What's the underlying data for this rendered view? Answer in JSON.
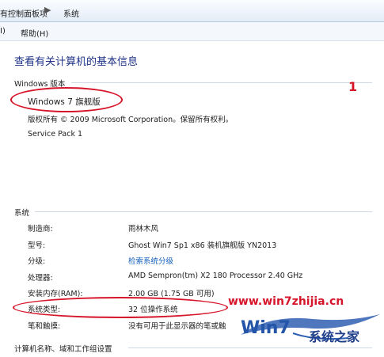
{
  "address_bar": {
    "breadcrumb_partial": "有控制面板项",
    "separator": "▶",
    "current": "系统"
  },
  "menu": {
    "partial_item": "I)",
    "help": "帮助(H)"
  },
  "title": "查看有关计算机的基本信息",
  "windows_edition": {
    "header": "Windows 版本",
    "edition": "Windows 7 旗舰版",
    "copyright": "版权所有 © 2009 Microsoft Corporation。保留所有权利。",
    "service_pack": "Service Pack 1"
  },
  "system": {
    "header": "系统",
    "rows": [
      {
        "label": "制造商:",
        "value": "雨林木风"
      },
      {
        "label": "型号:",
        "value": "Ghost Win7 Sp1 x86 装机旗舰版 YN2013"
      },
      {
        "label": "分级:",
        "value": "检索系统分级"
      },
      {
        "label": "处理器:",
        "value": "AMD Sempron(tm) X2 180 Processor   2.40 GHz"
      },
      {
        "label": "安装内存(RAM):",
        "value": "2.00 GB (1.75 GB 可用)"
      },
      {
        "label": "系统类型:",
        "value": "32 位操作系统"
      },
      {
        "label": "笔和触摸:",
        "value": "没有可用于此显示器的笔或触"
      }
    ]
  },
  "computer_name_section": {
    "header": "计算机名称、域和工作组设置"
  },
  "annotations": {
    "number": "1",
    "color": "#d6142a"
  },
  "watermark": {
    "url": "www.win7zhijia.cn",
    "brand": "系统之家",
    "logo_text": "Win7"
  },
  "colors": {
    "title": "#1e3287",
    "link": "#1560bd",
    "annotation_red": "#d6142a"
  }
}
